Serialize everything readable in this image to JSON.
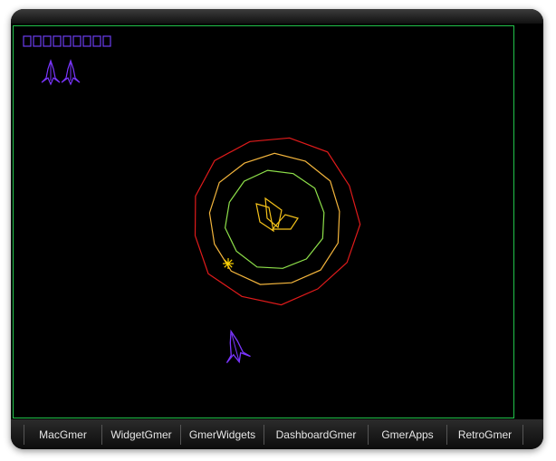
{
  "game": {
    "score_boxes": 9,
    "lives": 2,
    "colors": {
      "border": "#21c24a",
      "score": "#6a3df0",
      "ship": "#7a35ff",
      "ring_outer": "#e01b1b",
      "ring_middle": "#f2b43c",
      "ring_inner": "#8ee04a",
      "core": "#f5c21a",
      "spark": "#ffd400"
    }
  },
  "nav": {
    "items": [
      {
        "label": "MacGmer"
      },
      {
        "label": "WidgetGmer"
      },
      {
        "label": "GmerWidgets"
      },
      {
        "label": "DashboardGmer"
      },
      {
        "label": "GmerApps"
      },
      {
        "label": "RetroGmer"
      }
    ]
  }
}
